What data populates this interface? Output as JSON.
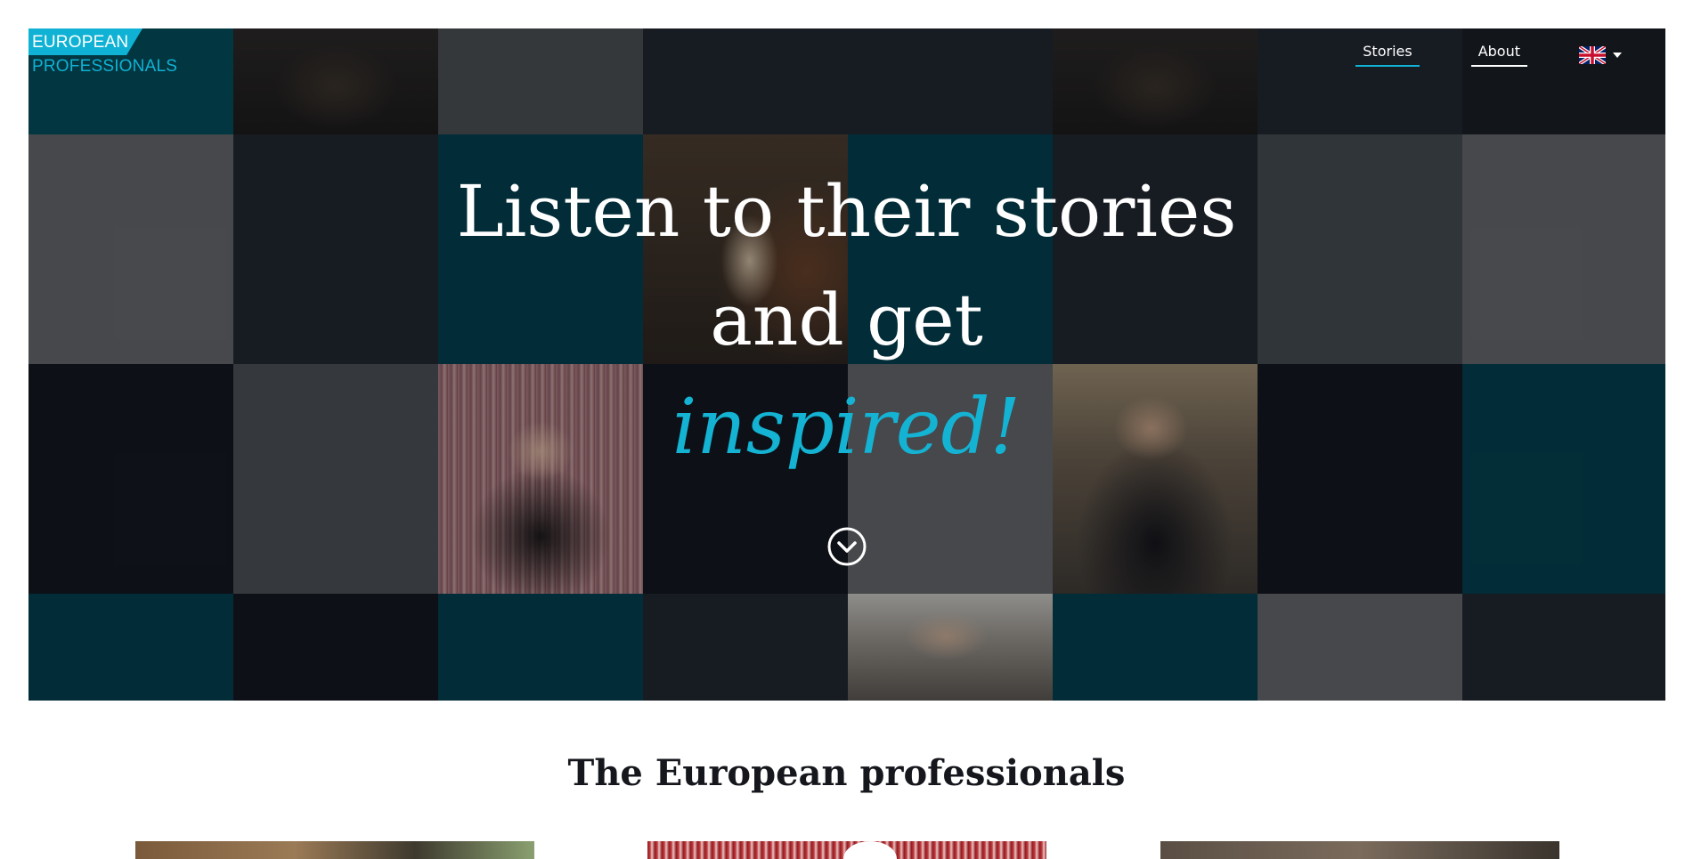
{
  "header": {
    "logo": {
      "line1": "EUROPEAN",
      "line2": "PROFESSIONALS"
    },
    "nav": {
      "stories": "Stories",
      "about": "About",
      "language_flag": "uk-flag-icon"
    }
  },
  "hero": {
    "line1": "Listen to their stories",
    "line2": "and get",
    "line3": "inspired!",
    "scroll_icon": "chevron-down-circle-icon",
    "colors": {
      "accent": "#0fb2d4",
      "teal_tile": "#013c49",
      "dark_tile": "#1f232b",
      "gray_tile": "#626468"
    }
  },
  "section": {
    "title": "The European professionals"
  }
}
